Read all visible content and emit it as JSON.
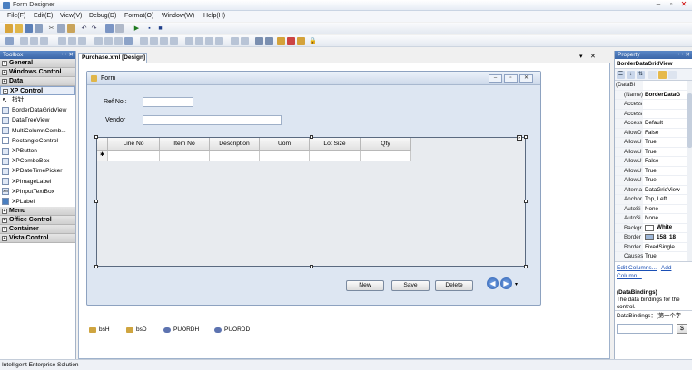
{
  "window": {
    "title": "Form Designer"
  },
  "menu": [
    "File(F)",
    "Edit(E)",
    "View(V)",
    "Debug(D)",
    "Format(O)",
    "Window(W)",
    "Help(H)"
  ],
  "toolbox": {
    "title": "Toolbox",
    "groups_top": [
      "General",
      "Windows Control",
      "Data"
    ],
    "xp_group": "XP Control",
    "items": [
      "指针",
      "BorderDataGridView",
      "DataTreeView",
      "MultiColumnComb...",
      "RectangleControl",
      "XPButton",
      "XPComboBox",
      "XPDateTimePicker",
      "XPImageLabel",
      "XPInputTextBox",
      "XPLabel"
    ],
    "groups_bottom": [
      "Menu",
      "Office Control",
      "Container",
      "Vista Control"
    ]
  },
  "designer": {
    "tab": "Purchase.xml [Design]",
    "form": {
      "caption": "Form",
      "ref_label": "Ref No.:",
      "vendor_label": "Vendor",
      "grid_columns": [
        "Line No",
        "Item No",
        "Description",
        "Uom",
        "Lot Size",
        "Qty"
      ],
      "row_marker": "✱",
      "buttons": {
        "new": "New",
        "save": "Save",
        "delete": "Delete"
      }
    },
    "components": [
      "bsH",
      "bsD",
      "PUORDH",
      "PUORDD"
    ]
  },
  "properties": {
    "title": "Property",
    "object": "BorderDataGridView",
    "rows": [
      {
        "name": "(DataBi",
        "value": ""
      },
      {
        "name": "(Name)",
        "value": "BorderDataG"
      },
      {
        "name": "Access",
        "value": ""
      },
      {
        "name": "Access",
        "value": ""
      },
      {
        "name": "Access",
        "value": "Default"
      },
      {
        "name": "AllowD",
        "value": "False"
      },
      {
        "name": "AllowU",
        "value": "True"
      },
      {
        "name": "AllowU",
        "value": "True"
      },
      {
        "name": "AllowU",
        "value": "False"
      },
      {
        "name": "AllowU",
        "value": "True"
      },
      {
        "name": "AllowU",
        "value": "True"
      },
      {
        "name": "Alterna",
        "value": "DataGridView"
      },
      {
        "name": "Anchor",
        "value": "Top, Left"
      },
      {
        "name": "AutoSi",
        "value": "None"
      },
      {
        "name": "AutoSi",
        "value": "None"
      },
      {
        "name": "Backgr",
        "value": "White"
      },
      {
        "name": "Border",
        "value": "158, 18"
      },
      {
        "name": "Border",
        "value": "FixedSingle"
      },
      {
        "name": "Causes",
        "value": "True"
      }
    ],
    "links": {
      "edit": "Edit Columns...",
      "add": "Add Column..."
    },
    "desc_title": "(DataBindings)",
    "desc_text": "The data bindings for the control.",
    "bindings_label": "DataBindings：(第一个字",
    "bottom_button": "$"
  },
  "status": {
    "text": "Intelligent Enterprise Solution"
  },
  "colors": {
    "swatch_white": "#ffffff",
    "swatch_border": "#9eb7d8",
    "accent": "#3b66a8"
  }
}
